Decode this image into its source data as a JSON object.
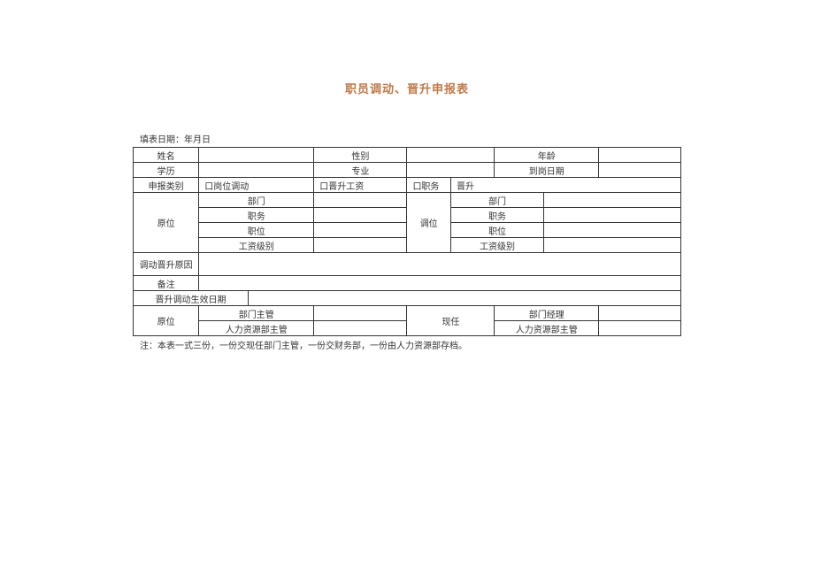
{
  "title": "职员调动、晋升申报表",
  "dateLine": "填表日期：年月日",
  "row1": {
    "name": "姓名",
    "gender": "性别",
    "age": "年龄"
  },
  "row2": {
    "edu": "学历",
    "major": "专业",
    "joinDate": "到岗日期"
  },
  "row3": {
    "label": "申报类别",
    "opt1": "口岗位调动",
    "opt2": "口晋升工资",
    "opt3": "口职务",
    "opt4": "晋升"
  },
  "block": {
    "leftHead": "原位",
    "rightHead": "调位",
    "dept": "部门",
    "duty": "职务",
    "position": "职位",
    "salaryLevel": "工资级别"
  },
  "reason": "调动晋升原因",
  "remark": "备注",
  "effectDate": "晋升调动生效日期",
  "sign": {
    "leftHead": "原位",
    "rightHead": "现任",
    "deptHead": "部门主管",
    "deptMgr": "部门经理",
    "hrHead": "人力资源部主管"
  },
  "footnote": "注：本表一式三份，一份交现任部门主管，一份交财务部，一份由人力资源部存档。"
}
